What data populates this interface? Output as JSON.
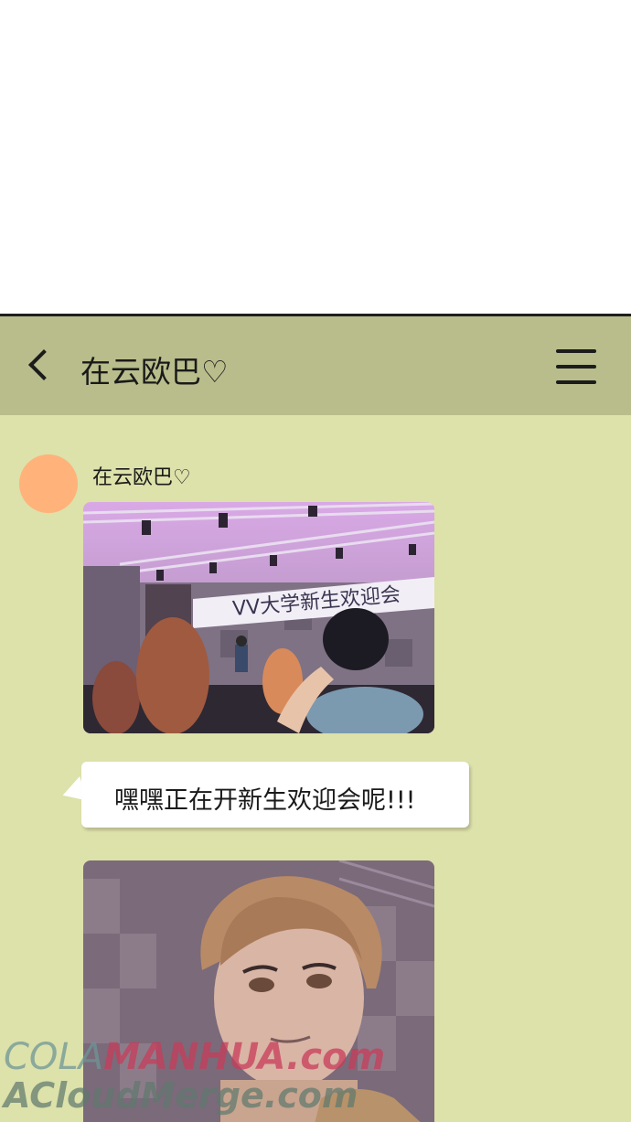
{
  "header": {
    "title": "在云欧巴♡"
  },
  "chat": {
    "sender_name": "在云欧巴♡",
    "image1": {
      "banner_text": "VV大学新生欢迎会"
    },
    "bubble_text": "嘿嘿正在开新生欢迎会呢!!!"
  },
  "watermark": {
    "line1_a": "COLA",
    "line1_b": "MANHUA.com",
    "line2": "ACloudMerge.com"
  },
  "colors": {
    "chat_background": "#dde1aa",
    "header_background": "#b8bd8b",
    "avatar": "#ffb27a"
  },
  "icons": [
    "back-arrow-icon",
    "hamburger-menu-icon"
  ]
}
